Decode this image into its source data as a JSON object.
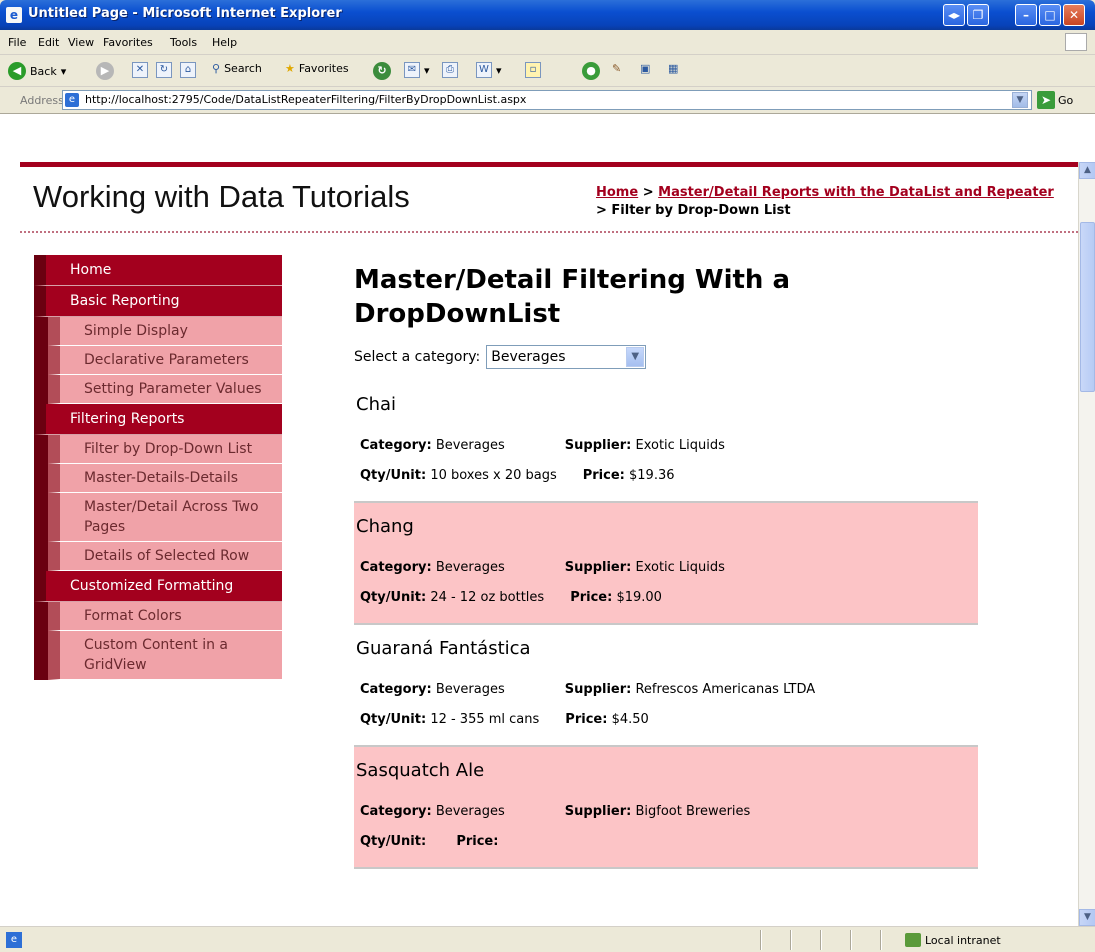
{
  "window": {
    "title": "Untitled Page - Microsoft Internet Explorer",
    "controls": [
      "◂▸",
      "❐",
      "–",
      "□",
      "✕"
    ]
  },
  "menu": {
    "items": [
      "File",
      "Edit",
      "View",
      "Favorites",
      "Tools",
      "Help"
    ]
  },
  "toolbar": {
    "back_label": "Back",
    "search_label": "Search",
    "favorites_label": "Favorites"
  },
  "address": {
    "label": "Address",
    "url": "http://localhost:2795/Code/DataListRepeaterFiltering/FilterByDropDownList.aspx",
    "go_label": "Go"
  },
  "page": {
    "site_title": "Working with Data Tutorials",
    "breadcrumb": {
      "home": "Home",
      "sep1": " > ",
      "section": "Master/Detail Reports with the DataList and Repeater",
      "sep2": " > ",
      "current": "Filter by Drop-Down List"
    },
    "heading": "Master/Detail Filtering With a DropDownList",
    "select_label": "Select a category:",
    "select_value": "Beverages"
  },
  "sidebar": {
    "items": [
      {
        "label": "Home",
        "level": "main"
      },
      {
        "label": "Basic Reporting",
        "level": "main"
      },
      {
        "label": "Simple Display",
        "level": "sub"
      },
      {
        "label": "Declarative Parameters",
        "level": "sub"
      },
      {
        "label": "Setting Parameter Values",
        "level": "sub"
      },
      {
        "label": "Filtering Reports",
        "level": "main"
      },
      {
        "label": "Filter by Drop-Down List",
        "level": "sub"
      },
      {
        "label": "Master-Details-Details",
        "level": "sub"
      },
      {
        "label": "Master/Detail Across Two Pages",
        "level": "sub"
      },
      {
        "label": "Details of Selected Row",
        "level": "sub"
      },
      {
        "label": "Customized Formatting",
        "level": "main"
      },
      {
        "label": "Format Colors",
        "level": "sub"
      },
      {
        "label": "Custom Content in a GridView",
        "level": "sub"
      }
    ]
  },
  "field_labels": {
    "category": "Category:",
    "supplier": "Supplier:",
    "qty": "Qty/Unit:",
    "price": "Price:"
  },
  "products": [
    {
      "name": "Chai",
      "category": "Beverages",
      "supplier": "Exotic Liquids",
      "qty": "10 boxes x 20 bags",
      "price": "$19.36",
      "alt": false
    },
    {
      "name": "Chang",
      "category": "Beverages",
      "supplier": "Exotic Liquids",
      "qty": "24 - 12 oz bottles",
      "price": "$19.00",
      "alt": true
    },
    {
      "name": "Guaraná Fantástica",
      "category": "Beverages",
      "supplier": "Refrescos Americanas LTDA",
      "qty": "12 - 355 ml cans",
      "price": "$4.50",
      "alt": false
    },
    {
      "name": "Sasquatch Ale",
      "category": "Beverages",
      "supplier": "Bigfoot Breweries",
      "qty": "",
      "price": "",
      "alt": true
    }
  ],
  "statusbar": {
    "zone": "Local intranet"
  },
  "colors": {
    "brand": "#a3001e",
    "sidebar_main": "#a3001e",
    "sidebar_sub": "#f0a2a8",
    "row_alt": "#fcc4c6"
  }
}
